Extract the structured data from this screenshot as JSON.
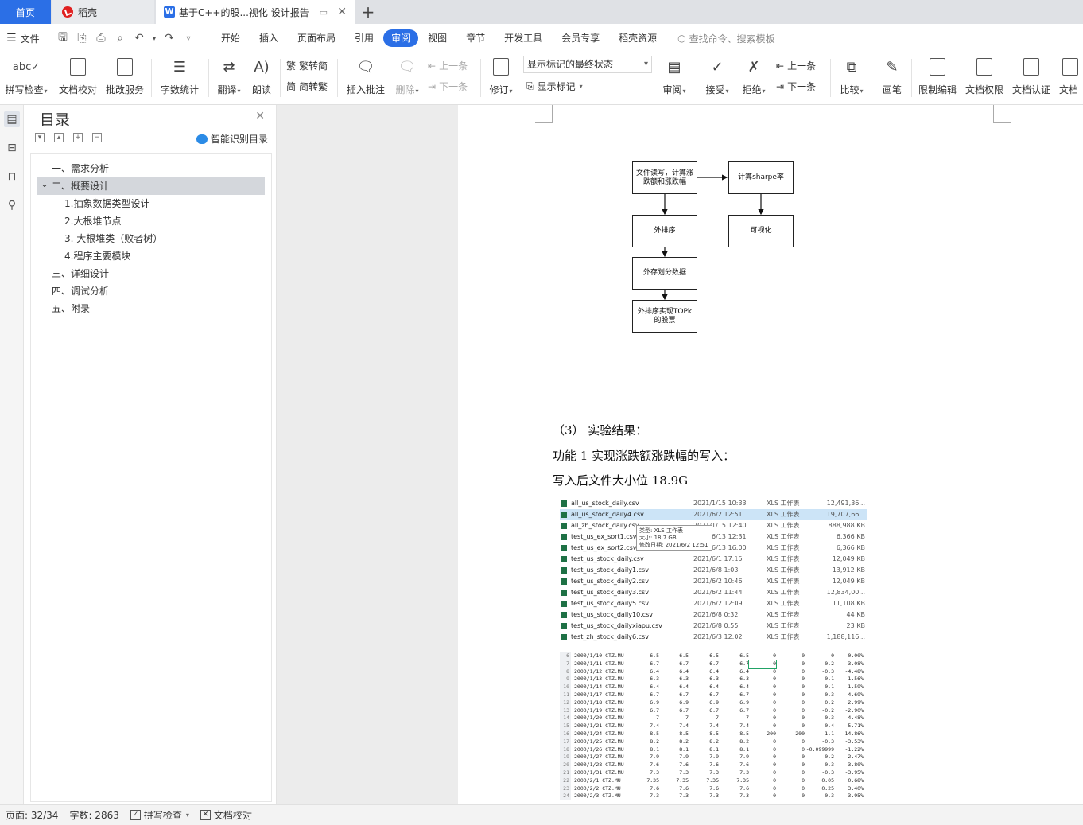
{
  "tabs": {
    "home": "首页",
    "daoke": "稻壳",
    "document": "基于C++的股...视化 设计报告",
    "new_tab": "+"
  },
  "menu": {
    "file": "文件",
    "items": [
      "开始",
      "插入",
      "页面布局",
      "引用",
      "审阅",
      "视图",
      "章节",
      "开发工具",
      "会员专享",
      "稻壳资源"
    ],
    "active_item": "审阅",
    "search_placeholder": "查找命令、搜索模板"
  },
  "ribbon": {
    "spell_check": "拼写检查",
    "doc_proof": "文档校对",
    "review_service": "批改服务",
    "word_count": "字数统计",
    "translate": "翻译",
    "read_aloud": "朗读",
    "to_traditional": "繁转简",
    "to_simplified": "简转繁",
    "insert_comment": "插入批注",
    "delete": "删除",
    "prev_comment": "上一条",
    "next_comment": "下一条",
    "track_changes": "修订",
    "markup_select": "显示标记的最终状态",
    "show_markup": "显示标记",
    "review": "审阅",
    "accept": "接受",
    "reject": "拒绝",
    "prev_change": "上一条",
    "next_change": "下一条",
    "compare": "比较",
    "pen": "画笔",
    "restrict_edit": "限制编辑",
    "doc_permission": "文档权限",
    "doc_certify": "文档认证",
    "doc_more": "文档"
  },
  "toc": {
    "title": "目录",
    "smart_button": "智能识别目录",
    "items": [
      {
        "label": "一、需求分析",
        "level": 1
      },
      {
        "label": "二、概要设计",
        "level": 1,
        "expanded": true,
        "selected": true
      },
      {
        "label": "1.抽象数据类型设计",
        "level": 2
      },
      {
        "label": "2.大根堆节点",
        "level": 2
      },
      {
        "label": "3. 大根堆类（败者树）",
        "level": 2
      },
      {
        "label": "4.程序主要模块",
        "level": 2
      },
      {
        "label": "三、详细设计",
        "level": 1
      },
      {
        "label": "四、调试分析",
        "level": 1
      },
      {
        "label": "五、附录",
        "level": 1
      }
    ]
  },
  "flowchart": {
    "nodes": {
      "read_write": "文件读写，计算涨跌额和涨跌幅",
      "sharpe": "计算sharpe率",
      "external_sort": "外排序",
      "visualize": "可视化",
      "split_data": "外存划分数据",
      "topk": "外排序实现TOPk的股票"
    }
  },
  "document": {
    "section_heading": "（3） 实验结果：",
    "feature_line": "功能 1 实现涨跌额涨跌幅的写入：",
    "size_line": "写入后文件大小位 18.9G"
  },
  "file_list": {
    "rows": [
      {
        "name": "all_us_stock_daily.csv",
        "date": "2021/1/15 10:33",
        "type": "XLS 工作表",
        "size": "12,491,36..."
      },
      {
        "name": "all_us_stock_daily4.csv",
        "date": "2021/6/2 12:51",
        "type": "XLS 工作表",
        "size": "19,707,66...",
        "highlight": true
      },
      {
        "name": "all_zh_stock_daily.csv",
        "date": "2021/1/15 12:40",
        "type": "XLS 工作表",
        "size": "888,988 KB"
      },
      {
        "name": "test_us_ex_sort1.csv",
        "date": "2021/6/13 12:31",
        "type": "XLS 工作表",
        "size": "6,366 KB"
      },
      {
        "name": "test_us_ex_sort2.csv",
        "date": "2021/6/13 16:00",
        "type": "XLS 工作表",
        "size": "6,366 KB"
      },
      {
        "name": "test_us_stock_daily.csv",
        "date": "2021/6/1 17:15",
        "type": "XLS 工作表",
        "size": "12,049 KB"
      },
      {
        "name": "test_us_stock_daily1.csv",
        "date": "2021/6/8 1:03",
        "type": "XLS 工作表",
        "size": "13,912 KB"
      },
      {
        "name": "test_us_stock_daily2.csv",
        "date": "2021/6/2 10:46",
        "type": "XLS 工作表",
        "size": "12,049 KB"
      },
      {
        "name": "test_us_stock_daily3.csv",
        "date": "2021/6/2 11:44",
        "type": "XLS 工作表",
        "size": "12,834,00..."
      },
      {
        "name": "test_us_stock_daily5.csv",
        "date": "2021/6/2 12:09",
        "type": "XLS 工作表",
        "size": "11,108 KB"
      },
      {
        "name": "test_us_stock_daily10.csv",
        "date": "2021/6/8 0:32",
        "type": "XLS 工作表",
        "size": "44 KB"
      },
      {
        "name": "test_us_stock_dailyxiapu.csv",
        "date": "2021/6/8 0:55",
        "type": "XLS 工作表",
        "size": "23 KB"
      },
      {
        "name": "test_zh_stock_daily6.csv",
        "date": "2021/6/3 12:02",
        "type": "XLS 工作表",
        "size": "1,188,116..."
      }
    ],
    "tooltip": {
      "type": "类型: XLS 工作表",
      "size": "大小: 18.7 GB",
      "modified": "修改日期: 2021/6/2 12:51"
    }
  },
  "sheet": {
    "rows": [
      [
        "6",
        "2000/1/10 CTZ.MU",
        "6.5",
        "6.5",
        "6.5",
        "6.5",
        "0",
        "0",
        "0",
        "0.00%"
      ],
      [
        "7",
        "2000/1/11 CTZ.MU",
        "6.7",
        "6.7",
        "6.7",
        "6.7",
        "0",
        "0",
        "0.2",
        "3.08%"
      ],
      [
        "8",
        "2000/1/12 CTZ.MU",
        "6.4",
        "6.4",
        "6.4",
        "6.4",
        "0",
        "0",
        "-0.3",
        "-4.48%"
      ],
      [
        "9",
        "2000/1/13 CTZ.MU",
        "6.3",
        "6.3",
        "6.3",
        "6.3",
        "0",
        "0",
        "-0.1",
        "-1.56%"
      ],
      [
        "10",
        "2000/1/14 CTZ.MU",
        "6.4",
        "6.4",
        "6.4",
        "6.4",
        "0",
        "0",
        "0.1",
        "1.59%"
      ],
      [
        "11",
        "2000/1/17 CTZ.MU",
        "6.7",
        "6.7",
        "6.7",
        "6.7",
        "0",
        "0",
        "0.3",
        "4.69%"
      ],
      [
        "12",
        "2000/1/18 CTZ.MU",
        "6.9",
        "6.9",
        "6.9",
        "6.9",
        "0",
        "0",
        "0.2",
        "2.99%"
      ],
      [
        "13",
        "2000/1/19 CTZ.MU",
        "6.7",
        "6.7",
        "6.7",
        "6.7",
        "0",
        "0",
        "-0.2",
        "-2.90%"
      ],
      [
        "14",
        "2000/1/20 CTZ.MU",
        "7",
        "7",
        "7",
        "7",
        "0",
        "0",
        "0.3",
        "4.48%"
      ],
      [
        "15",
        "2000/1/21 CTZ.MU",
        "7.4",
        "7.4",
        "7.4",
        "7.4",
        "0",
        "0",
        "0.4",
        "5.71%"
      ],
      [
        "16",
        "2000/1/24 CTZ.MU",
        "8.5",
        "8.5",
        "8.5",
        "8.5",
        "200",
        "200",
        "1.1",
        "14.86%"
      ],
      [
        "17",
        "2000/1/25 CTZ.MU",
        "8.2",
        "8.2",
        "8.2",
        "8.2",
        "0",
        "0",
        "-0.3",
        "-3.53%"
      ],
      [
        "18",
        "2000/1/26 CTZ.MU",
        "8.1",
        "8.1",
        "8.1",
        "8.1",
        "0",
        "0",
        "-0.099999",
        "-1.22%"
      ],
      [
        "19",
        "2000/1/27 CTZ.MU",
        "7.9",
        "7.9",
        "7.9",
        "7.9",
        "0",
        "0",
        "-0.2",
        "-2.47%"
      ],
      [
        "20",
        "2000/1/28 CTZ.MU",
        "7.6",
        "7.6",
        "7.6",
        "7.6",
        "0",
        "0",
        "-0.3",
        "-3.80%"
      ],
      [
        "21",
        "2000/1/31 CTZ.MU",
        "7.3",
        "7.3",
        "7.3",
        "7.3",
        "0",
        "0",
        "-0.3",
        "-3.95%"
      ],
      [
        "22",
        "2000/2/1 CTZ.MU",
        "7.35",
        "7.35",
        "7.35",
        "7.35",
        "0",
        "0",
        "0.05",
        "0.68%"
      ],
      [
        "23",
        "2000/2/2 CTZ.MU",
        "7.6",
        "7.6",
        "7.6",
        "7.6",
        "0",
        "0",
        "0.25",
        "3.40%"
      ],
      [
        "24",
        "2000/2/3 CTZ.MU",
        "7.3",
        "7.3",
        "7.3",
        "7.3",
        "0",
        "0",
        "-0.3",
        "-3.95%"
      ]
    ]
  },
  "status": {
    "page": "页面: 32/34",
    "words": "字数: 2863",
    "spell": "拼写检查",
    "proof": "文档校对"
  },
  "colors": {
    "accent": "#2b6fe6",
    "toc_selected": "#d4d7dc",
    "workspace": "#ececec"
  }
}
